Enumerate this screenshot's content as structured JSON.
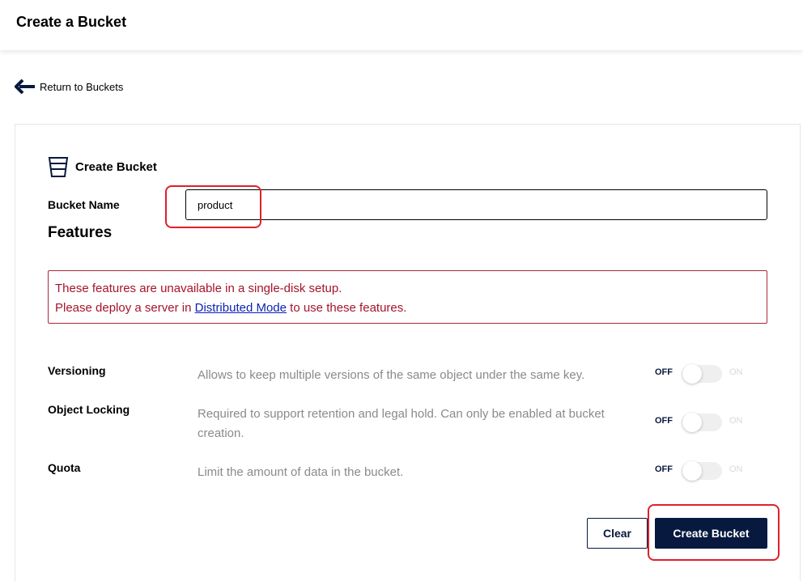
{
  "header": {
    "title": "Create a Bucket"
  },
  "back_link": {
    "label": "Return to Buckets"
  },
  "section": {
    "title": "Create Bucket"
  },
  "bucket_name": {
    "label": "Bucket Name",
    "value": "product"
  },
  "features": {
    "title": "Features",
    "warning": {
      "line1": "These features are unavailable in a single-disk setup.",
      "line2_before": "Please deploy a server in ",
      "line2_link": "Distributed Mode",
      "line2_after": " to use these features."
    },
    "items": [
      {
        "name": "Versioning",
        "description": "Allows to keep multiple versions of the same object under the same key.",
        "off_label": "OFF",
        "on_label": "ON",
        "enabled": false
      },
      {
        "name": "Object Locking",
        "description": "Required to support retention and legal hold. Can only be enabled at bucket creation.",
        "off_label": "OFF",
        "on_label": "ON",
        "enabled": false
      },
      {
        "name": "Quota",
        "description": "Limit the amount of data in the bucket.",
        "off_label": "OFF",
        "on_label": "ON",
        "enabled": false
      }
    ]
  },
  "actions": {
    "clear_label": "Clear",
    "create_label": "Create Bucket"
  },
  "colors": {
    "primary": "#07193e",
    "warning": "#a5142a",
    "link": "#0b1fb5",
    "highlight": "#e0202a"
  }
}
